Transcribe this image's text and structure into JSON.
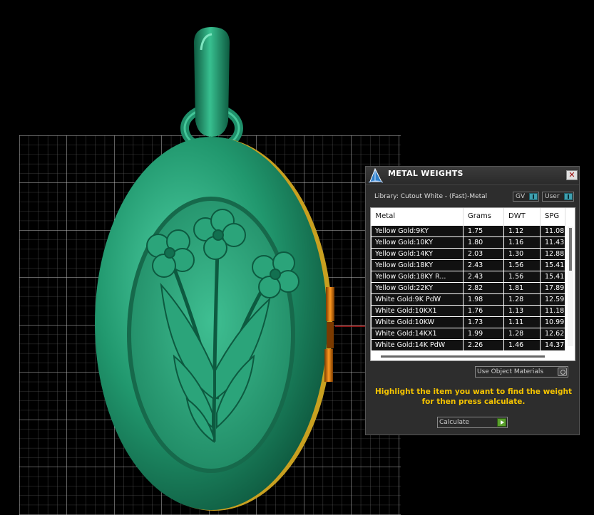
{
  "panel": {
    "title": "METAL WEIGHTS",
    "close_glyph": "✕",
    "library_label": "Library: Cutout White - (Fast)-Metal",
    "toggles": {
      "gv": "GV",
      "user": "User"
    },
    "columns": [
      "Metal",
      "Grams",
      "DWT",
      "SPG"
    ],
    "rows": [
      [
        "Yellow Gold:9KY",
        "1.75",
        "1.12",
        "11.08"
      ],
      [
        "Yellow Gold:10KY",
        "1.80",
        "1.16",
        "11.43"
      ],
      [
        "Yellow Gold:14KY",
        "2.03",
        "1.30",
        "12.88"
      ],
      [
        "Yellow Gold:18KY",
        "2.43",
        "1.56",
        "15.41"
      ],
      [
        "Yellow Gold:18KY R...",
        "2.43",
        "1.56",
        "15.41"
      ],
      [
        "Yellow Gold:22KY",
        "2.82",
        "1.81",
        "17.89"
      ],
      [
        "White Gold:9K PdW",
        "1.98",
        "1.28",
        "12.59"
      ],
      [
        "White Gold:10KX1",
        "1.76",
        "1.13",
        "11.18"
      ],
      [
        "White Gold:10KW",
        "1.73",
        "1.11",
        "10.99"
      ],
      [
        "White Gold:14KX1",
        "1.99",
        "1.28",
        "12.62"
      ],
      [
        "White Gold:14K PdW",
        "2.26",
        "1.46",
        "14.37"
      ]
    ],
    "use_object_materials": "Use Object Materials",
    "hint": "Highlight the item you want to find the weight for then press calculate.",
    "calculate": "Calculate"
  },
  "colors": {
    "model_green": "#1f8f6a",
    "grid": "#9a9a9a",
    "hint": "#f5c400",
    "hinge": "#e07a10"
  }
}
